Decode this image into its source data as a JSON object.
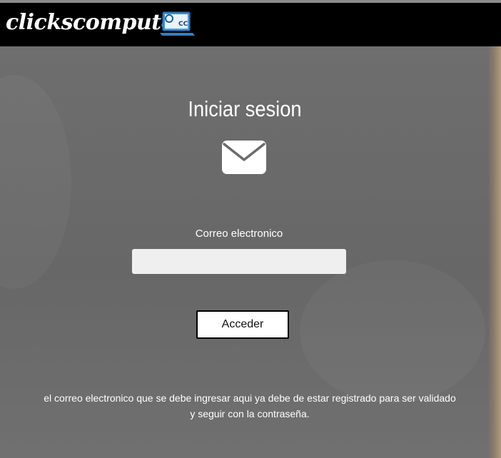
{
  "header": {
    "brand": "clickscomputer",
    "logo_text": "CC",
    "logo_icon": "laptop-logo-icon"
  },
  "main": {
    "title": "Iniciar sesion",
    "mail_icon": "envelope-icon",
    "email_label": "Correo electronico",
    "email_value": "",
    "email_placeholder": "",
    "submit_label": "Acceder",
    "note": "el correo electronico que se debe ingresar aqui ya debe de estar registrado para ser validado y seguir con la contraseña."
  },
  "colors": {
    "header_bg": "#000000",
    "page_bg": "#6b6b6b",
    "input_bg": "#efefef",
    "button_bg": "#ffffff",
    "text": "#ffffff"
  }
}
